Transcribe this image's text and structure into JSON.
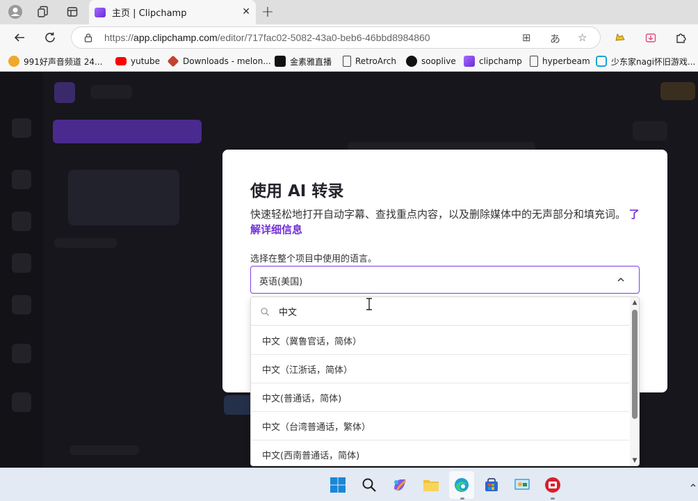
{
  "browser": {
    "tab": {
      "title": "主页 | Clipchamp"
    },
    "url": {
      "scheme": "https://",
      "host": "app.clipchamp.com",
      "path": "/editor/717fac02-5082-43a0-beb6-46bbd8984860"
    },
    "bookmarks": [
      {
        "label": "991好声音频道 24...",
        "icon": "tiger-icon",
        "color": "#f0a82a"
      },
      {
        "label": "yutube",
        "icon": "youtube-icon",
        "color": "#ff0000"
      },
      {
        "label": "Downloads - melon...",
        "icon": "melon-icon",
        "color": "#c0442e"
      },
      {
        "label": "金素雅直播",
        "icon": "z-icon",
        "color": "#111111"
      },
      {
        "label": "RetroArch",
        "icon": "page-icon",
        "color": "#ffffff"
      },
      {
        "label": "sooplive",
        "icon": "infinity-icon",
        "color": "#111111"
      },
      {
        "label": "clipchamp",
        "icon": "clipchamp-icon",
        "color": "#8a4ddf"
      },
      {
        "label": "hyperbeam",
        "icon": "page-icon",
        "color": "#ffffff"
      },
      {
        "label": "少东家nagi怀旧游戏...",
        "icon": "bilibili-icon",
        "color": "#18a4d8"
      }
    ]
  },
  "modal": {
    "title": "使用 AI 转录",
    "description": "快速轻松地打开自动字幕、查找重点内容，以及删除媒体中的无声部分和填充词。",
    "learn_more": "了解详细信息",
    "language_label": "选择在整个项目中使用的语言。",
    "selected_language": "英语(美国)"
  },
  "dropdown": {
    "search_value": "中文",
    "options": [
      "中文（冀鲁官话，简体）",
      "中文（江浙话，简体）",
      "中文(普通话，简体)",
      "中文（台湾普通话，繁体）",
      "中文(西南普通话，简体)"
    ]
  },
  "colors": {
    "accent": "#7b3fe4",
    "link": "#7432d8"
  }
}
